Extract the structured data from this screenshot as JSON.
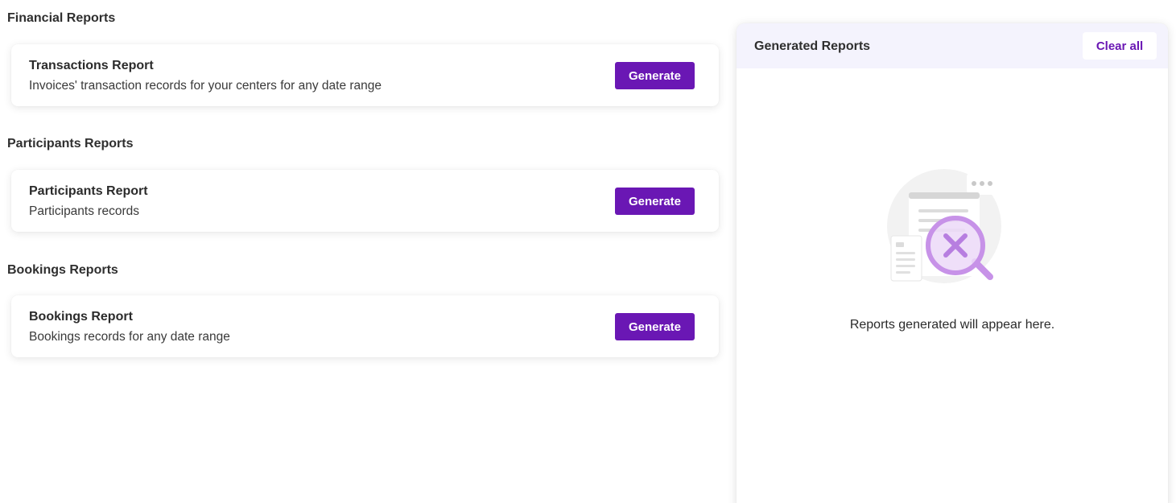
{
  "sections": [
    {
      "title": "Financial Reports",
      "report": {
        "name": "Transactions Report",
        "description": "Invoices' transaction records for your centers for any date range",
        "button_label": "Generate"
      }
    },
    {
      "title": "Participants Reports",
      "report": {
        "name": "Participants Report",
        "description": "Participants records",
        "button_label": "Generate"
      }
    },
    {
      "title": "Bookings Reports",
      "report": {
        "name": "Bookings Report",
        "description": "Bookings records for any date range",
        "button_label": "Generate"
      }
    }
  ],
  "generated_panel": {
    "title": "Generated Reports",
    "clear_label": "Clear all",
    "empty_message": "Reports generated will appear here.",
    "empty_icon": "no-results-search-icon"
  },
  "colors": {
    "accent": "#6a17b4",
    "panel_header_bg": "#f4f3fd",
    "illustration_purple": "#c792e8"
  }
}
